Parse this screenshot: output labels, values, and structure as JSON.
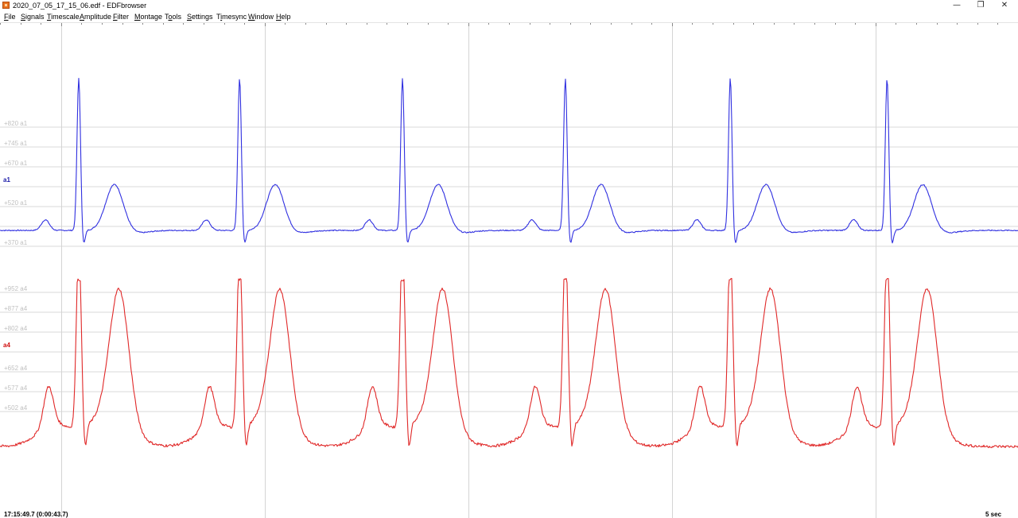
{
  "window": {
    "title": "2020_07_05_17_15_06.edf - EDFbrowser",
    "controls": {
      "minimize": "—",
      "restore": "❐",
      "close": "✕"
    }
  },
  "menu": [
    "File",
    "Signals",
    "Timescale",
    "Amplitude",
    "Filter",
    "Montage",
    "Tools",
    "Settings",
    "Timesync",
    "Window",
    "Help"
  ],
  "menu_access_keys": [
    "F",
    "S",
    "T",
    "A",
    "F",
    "M",
    "o",
    "S",
    "i",
    "W",
    "H"
  ],
  "status": {
    "time": "17:15:49.7 (0:00:43.7)",
    "timescale": "5 sec"
  },
  "colors": {
    "signal_a1": "#3030e0",
    "signal_a4": "#e02828",
    "label_a1": "#1a1aa8",
    "label_a4": "#d01010",
    "grid": "#d9d9d9",
    "grid_label": "#c0c0c0",
    "time_marker": "#d4d4d4"
  },
  "chart_data": [
    {
      "type": "line",
      "signal": "a1",
      "grid_labels": [
        "+820 a1",
        "+745 a1",
        "+670 a1",
        "+520 a1",
        "+370 a1"
      ],
      "grid_values": [
        820,
        745,
        670,
        595,
        520,
        445,
        370
      ],
      "beat_times_sec": [
        0.34,
        1.13,
        1.93,
        2.73,
        3.54,
        4.31
      ],
      "approx_range": [
        400,
        1010
      ]
    },
    {
      "type": "line",
      "signal": "a4",
      "grid_labels": [
        "+952 a4",
        "+877 a4",
        "+802 a4",
        "+652 a4",
        "+577 a4",
        "+502 a4"
      ],
      "grid_values": [
        952,
        877,
        802,
        727,
        652,
        577,
        502
      ],
      "beat_times_sec": [
        0.34,
        1.13,
        1.93,
        2.73,
        3.54,
        4.31
      ],
      "clipped_at": 1000,
      "approx_range": [
        320,
        1000
      ]
    }
  ],
  "timeline": {
    "visible_seconds": 5,
    "major_marks_sec": [
      0.3,
      1.3,
      2.3,
      3.3,
      4.3
    ]
  }
}
